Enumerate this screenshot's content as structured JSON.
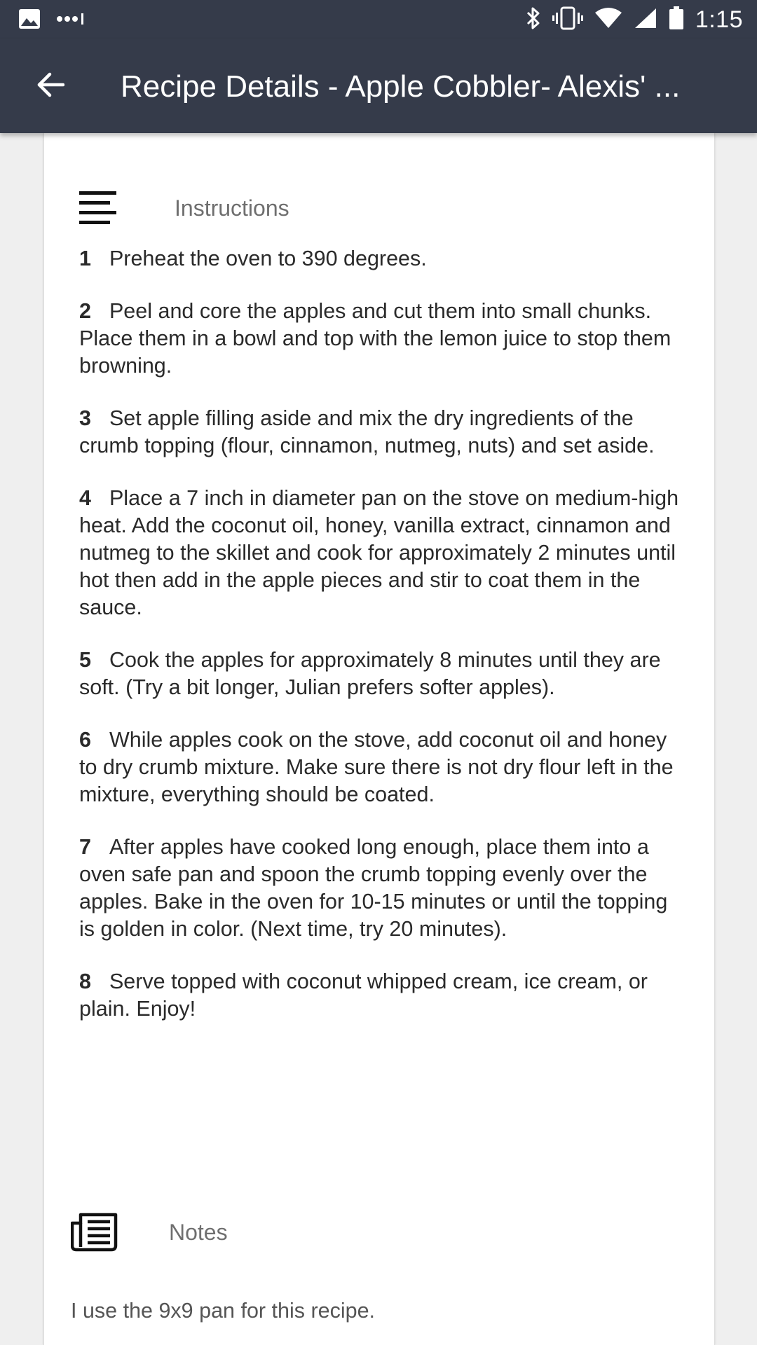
{
  "status_bar": {
    "time": "1:15",
    "icons": [
      "image-icon",
      "more-dots-icon",
      "bluetooth-icon",
      "vibrate-icon",
      "wifi-icon",
      "signal-icon",
      "battery-icon"
    ]
  },
  "app_bar": {
    "title": "Recipe Details - Apple Cobbler- Alexis' ...",
    "back_icon": "arrow-back-icon"
  },
  "instructions": {
    "heading": "Instructions",
    "icon": "text-lines-icon",
    "steps": [
      {
        "num": "1",
        "text": "Preheat the oven to 390 degrees."
      },
      {
        "num": "2",
        "text": "Peel and core the apples and cut them into small chunks. Place them in a bowl and top with the lemon juice to stop them browning."
      },
      {
        "num": "3",
        "text": "Set apple filling aside and mix the dry ingredients of the crumb topping (flour, cinnamon, nutmeg, nuts) and set aside."
      },
      {
        "num": "4",
        "text": "Place a 7 inch in diameter pan on the stove on medium-high heat. Add the coconut oil, honey, vanilla extract, cinnamon and nutmeg to the skillet and cook for approximately 2 minutes until hot then add in the apple pieces and stir to coat them in the sauce."
      },
      {
        "num": "5",
        "text": "Cook the apples for approximately 8 minutes until they are soft. (Try a bit longer, Julian prefers softer apples)."
      },
      {
        "num": "6",
        "text": "While apples cook on the stove, add coconut oil and honey to dry crumb mixture. Make sure there is not dry flour left in the mixture, everything should be coated."
      },
      {
        "num": "7",
        "text": "After apples have cooked long enough, place them into a oven safe pan and spoon the crumb topping evenly over the apples. Bake in the oven for 10-15 minutes or until the topping is golden in color. (Next time, try 20 minutes)."
      },
      {
        "num": "8",
        "text": "Serve topped with coconut whipped cream, ice cream, or plain. Enjoy!"
      }
    ]
  },
  "notes": {
    "heading": "Notes",
    "icon": "notes-icon",
    "text": "I use the 9x9 pan for this recipe."
  },
  "colors": {
    "app_bar": "#353b4a",
    "background": "#efefef",
    "card": "#ffffff"
  }
}
